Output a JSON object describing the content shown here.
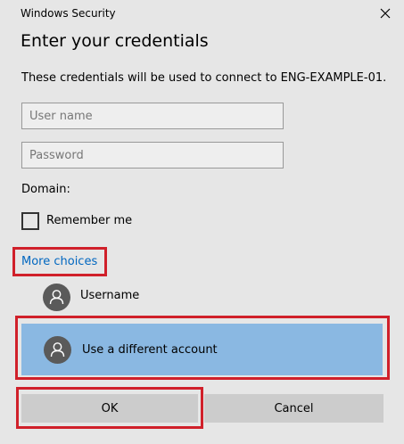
{
  "window": {
    "title": "Windows Security",
    "close_icon": "close-icon"
  },
  "dialog": {
    "heading": "Enter your credentials",
    "description": "These credentials will be used to connect to ENG-EXAMPLE-01."
  },
  "fields": {
    "username_placeholder": "User name",
    "password_placeholder": "Password",
    "domain_label": "Domain:"
  },
  "remember": {
    "label": "Remember me",
    "checked": false
  },
  "more_choices": {
    "label": "More choices"
  },
  "accounts": [
    {
      "label": "Username",
      "icon": "user-avatar-icon",
      "selected": false
    },
    {
      "label": "Use a different account",
      "icon": "user-avatar-icon",
      "selected": true
    }
  ],
  "buttons": {
    "ok": "OK",
    "cancel": "Cancel"
  },
  "colors": {
    "background": "#e6e6e6",
    "selection": "#8ab8e2",
    "link": "#0067c0",
    "highlight_border": "#d0202a",
    "button": "#cccccc",
    "avatar": "#5a5a5a"
  }
}
